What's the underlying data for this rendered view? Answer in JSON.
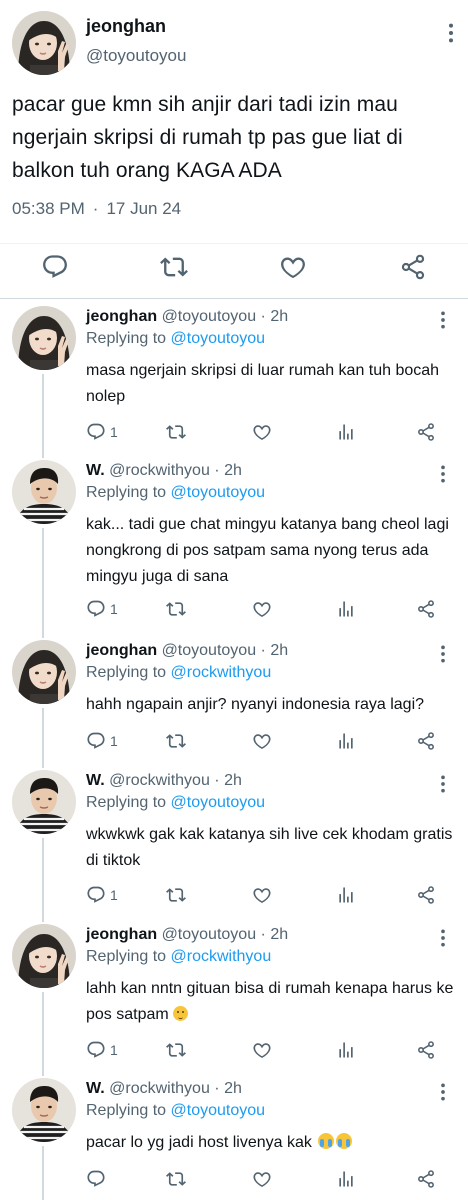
{
  "colors": {
    "text": "#0f1419",
    "muted": "#536471",
    "link": "#1d9bf0",
    "divider": "#eff3f4"
  },
  "main_tweet": {
    "name": "jeonghan",
    "handle": "@toyoutoyou",
    "text": "pacar gue kmn sih anjir dari tadi izin mau ngerjain skripsi di rumah tp pas gue liat di balkon tuh orang KAGA ADA",
    "time": "05:38 PM",
    "date": "17 Jun 24",
    "actions": [
      "reply-icon",
      "retweet-icon",
      "like-icon",
      "share-icon"
    ]
  },
  "replies": [
    {
      "name": "jeonghan",
      "handle": "@toyoutoyou",
      "age": "2h",
      "replying_prefix": "Replying to",
      "replying_to": "@toyoutoyou",
      "text": "masa ngerjain skripsi di luar rumah kan tuh bocah nolep",
      "reply_count": "1",
      "avatar": "avatar-jeonghan"
    },
    {
      "name": "W.",
      "handle": "@rockwithyou",
      "age": "2h",
      "replying_prefix": "Replying to",
      "replying_to": "@toyoutoyou",
      "text": "kak... tadi gue chat mingyu katanya bang cheol lagi nongkrong di pos satpam sama nyong terus ada mingyu juga di sana",
      "reply_count": "1",
      "avatar": "avatar-w"
    },
    {
      "name": "jeonghan",
      "handle": "@toyoutoyou",
      "age": "2h",
      "replying_prefix": "Replying to",
      "replying_to": "@rockwithyou",
      "text": "hahh ngapain anjir? nyanyi indonesia raya lagi?",
      "reply_count": "1",
      "avatar": "avatar-jeonghan"
    },
    {
      "name": "W.",
      "handle": "@rockwithyou",
      "age": "2h",
      "replying_prefix": "Replying to",
      "replying_to": "@toyoutoyou",
      "text": "wkwkwk gak kak katanya sih live cek khodam gratis di tiktok",
      "reply_count": "1",
      "avatar": "avatar-w"
    },
    {
      "name": "jeonghan",
      "handle": "@toyoutoyou",
      "age": "2h",
      "replying_prefix": "Replying to",
      "replying_to": "@rockwithyou",
      "text": "lahh kan nntn gituan bisa di rumah kenapa harus ke pos satpam",
      "emoji": "slightly-frowning-emoji",
      "reply_count": "1",
      "avatar": "avatar-jeonghan"
    },
    {
      "name": "W.",
      "handle": "@rockwithyou",
      "age": "2h",
      "replying_prefix": "Replying to",
      "replying_to": "@toyoutoyou",
      "text": "pacar lo yg jadi host livenya kak",
      "emoji": "crying-emoji",
      "reply_count": "",
      "avatar": "avatar-w"
    }
  ]
}
